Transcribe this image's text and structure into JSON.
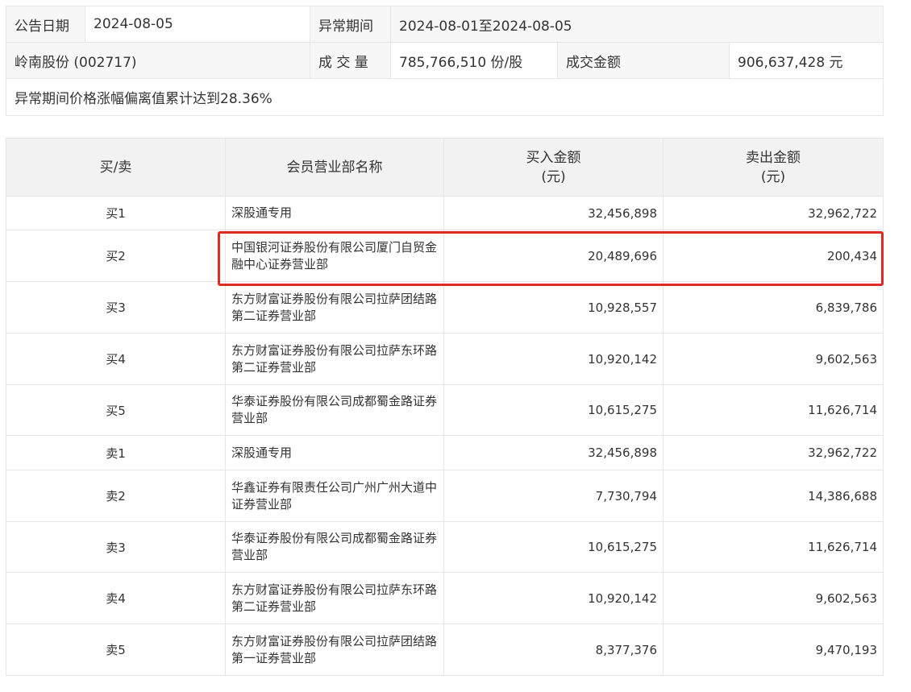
{
  "info": {
    "announce_date_label": "公告日期",
    "announce_date_value": "2024-08-05",
    "abnormal_period_label": "异常期间",
    "abnormal_period_value": "2024-08-01至2024-08-05",
    "stock_name": "岭南股份 (002717)",
    "volume_label": "成 交 量",
    "volume_value": "785,766,510 份/股",
    "turnover_label": "成交金额",
    "turnover_value": "906,637,428 元",
    "reason": "异常期间价格涨幅偏离值累计达到28.36%"
  },
  "table": {
    "headers": {
      "side": "买/卖",
      "dept": "会员营业部名称",
      "buy_line1": "买入金额",
      "buy_line2": "(元)",
      "sell_line1": "卖出金额",
      "sell_line2": "(元)"
    },
    "rows": [
      {
        "side": "买1",
        "dept": "深股通专用",
        "buy": "32,456,898",
        "sell": "32,962,722"
      },
      {
        "side": "买2",
        "dept": "中国银河证券股份有限公司厦门自贸金融中心证券营业部",
        "buy": "20,489,696",
        "sell": "200,434"
      },
      {
        "side": "买3",
        "dept": "东方财富证券股份有限公司拉萨团结路第二证券营业部",
        "buy": "10,928,557",
        "sell": "6,839,786"
      },
      {
        "side": "买4",
        "dept": "东方财富证券股份有限公司拉萨东环路第二证券营业部",
        "buy": "10,920,142",
        "sell": "9,602,563"
      },
      {
        "side": "买5",
        "dept": "华泰证券股份有限公司成都蜀金路证券营业部",
        "buy": "10,615,275",
        "sell": "11,626,714"
      },
      {
        "side": "卖1",
        "dept": "深股通专用",
        "buy": "32,456,898",
        "sell": "32,962,722"
      },
      {
        "side": "卖2",
        "dept": "华鑫证券有限责任公司广州广州大道中证券营业部",
        "buy": "7,730,794",
        "sell": "14,386,688"
      },
      {
        "side": "卖3",
        "dept": "华泰证券股份有限公司成都蜀金路证券营业部",
        "buy": "10,615,275",
        "sell": "11,626,714"
      },
      {
        "side": "卖4",
        "dept": "东方财富证券股份有限公司拉萨东环路第二证券营业部",
        "buy": "10,920,142",
        "sell": "9,602,563"
      },
      {
        "side": "卖5",
        "dept": "东方财富证券股份有限公司拉萨团结路第一证券营业部",
        "buy": "8,377,376",
        "sell": "9,470,193"
      }
    ]
  },
  "highlight": {
    "row": 2,
    "color": "#e02b25"
  }
}
